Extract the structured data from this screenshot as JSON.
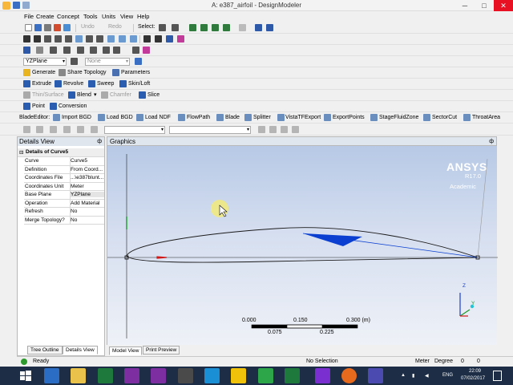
{
  "window": {
    "title": "A: e387_airfoil - DesignModeler",
    "minimize": "─",
    "maximize": "□",
    "close": "✕"
  },
  "menu": [
    "File",
    "Create",
    "Concept",
    "Tools",
    "Units",
    "View",
    "Help"
  ],
  "toolbar1": {
    "undo": "Undo",
    "redo": "Redo",
    "select_label": "Select:"
  },
  "plane_toolbar": {
    "plane": "YZPlane",
    "sketch": "None"
  },
  "toolbar_generate": {
    "generate": "Generate",
    "share_topology": "Share Topology",
    "parameters": "Parameters"
  },
  "toolbar_features": {
    "extrude": "Extrude",
    "revolve": "Revolve",
    "sweep": "Sweep",
    "skin_loft": "Skin/Loft"
  },
  "toolbar_features2": {
    "thin_surface": "Thin/Surface",
    "blend": "Blend",
    "chamfer": "Chamfer",
    "slice": "Slice"
  },
  "toolbar_point": {
    "point": "Point",
    "conversion": "Conversion"
  },
  "bladeeditor": {
    "label": "BladeEditor:",
    "items": [
      "Import BGD",
      "Load BGD",
      "Load NDF",
      "FlowPath",
      "Blade",
      "Splitter",
      "VistaTFExport",
      "ExportPoints",
      "StageFluidZone",
      "SectorCut",
      "ThroatArea"
    ]
  },
  "details": {
    "header": "Details View",
    "pin": "ф",
    "group_title": "Details of Curve5",
    "rows": [
      {
        "key": "Curve",
        "value": "Curve5"
      },
      {
        "key": "Definition",
        "value": "From Coord..."
      },
      {
        "key": "Coordinates File",
        "value": "...\\e387blunt..."
      },
      {
        "key": "Coordinates Unit",
        "value": "Meter"
      },
      {
        "key": "Base Plane",
        "value": "YZPlane"
      },
      {
        "key": "Operation",
        "value": "Add Material"
      },
      {
        "key": "Refresh",
        "value": "No"
      },
      {
        "key": "Merge Topology?",
        "value": "No"
      }
    ],
    "tabs": [
      "Tree Outline",
      "Details View"
    ]
  },
  "graphics": {
    "header": "Graphics",
    "pin": "ф",
    "brand": "ANSYS",
    "version": "R17.0",
    "edition": "Academic",
    "triad": {
      "z": "Z",
      "y": "Y"
    },
    "scale": {
      "top": [
        "0.000",
        "0.150",
        "0.300 (m)"
      ],
      "bottom": [
        "0.075",
        "0.225"
      ]
    },
    "tabs": [
      "Model View",
      "Print Preview"
    ]
  },
  "status": {
    "ready": "Ready",
    "selection": "No Selection",
    "unit": "Meter",
    "angle": "Degree",
    "v1": "0",
    "v2": "0"
  },
  "taskbar": {
    "lang": "ENG",
    "time": "22:09",
    "date": "07/02/2017"
  },
  "colors": {
    "accent_blue": "#0a3fd1",
    "viewport_top": "#b7c9e6",
    "taskbar": "#1c2d45",
    "close_red": "#e81123"
  }
}
